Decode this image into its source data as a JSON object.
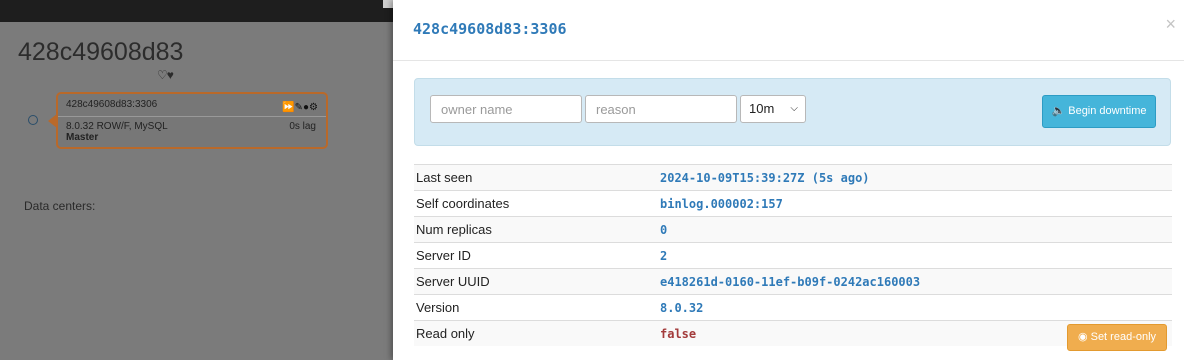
{
  "background": {
    "cluster_title": "428c49608d83",
    "hearts": "♡♥",
    "node": {
      "name": "428c49608d83:3306",
      "icons": "⏩✎●⚙",
      "version_line": "8.0.32 ROW/F, MySQL",
      "lag": "0s lag",
      "role": "Master"
    },
    "data_centers_label": "Data centers:"
  },
  "modal": {
    "title": "428c49608d83:3306",
    "close": "×",
    "downtime": {
      "owner_placeholder": "owner name",
      "reason_placeholder": "reason",
      "duration": "10m",
      "begin_label": "Begin downtime",
      "begin_icon": "volume-off-icon"
    },
    "rows": [
      {
        "key": "Last seen",
        "value": "2024-10-09T15:39:27Z (5s ago)"
      },
      {
        "key": "Self coordinates",
        "value": "binlog.000002:157"
      },
      {
        "key": "Num replicas",
        "value": "0"
      },
      {
        "key": "Server ID",
        "value": "2"
      },
      {
        "key": "Server UUID",
        "value": "e418261d-0160-11ef-b09f-0242ac160003"
      },
      {
        "key": "Version",
        "value": "8.0.32"
      },
      {
        "key": "Read only",
        "value": "false"
      }
    ],
    "set_read_only_label": "◉ Set read-only"
  },
  "colors": {
    "accent": "#2f7ab8",
    "warning": "#f0ad4e",
    "info_button": "#45b5da",
    "false_value": "#a33b3b",
    "node_border": "#b9692a"
  }
}
